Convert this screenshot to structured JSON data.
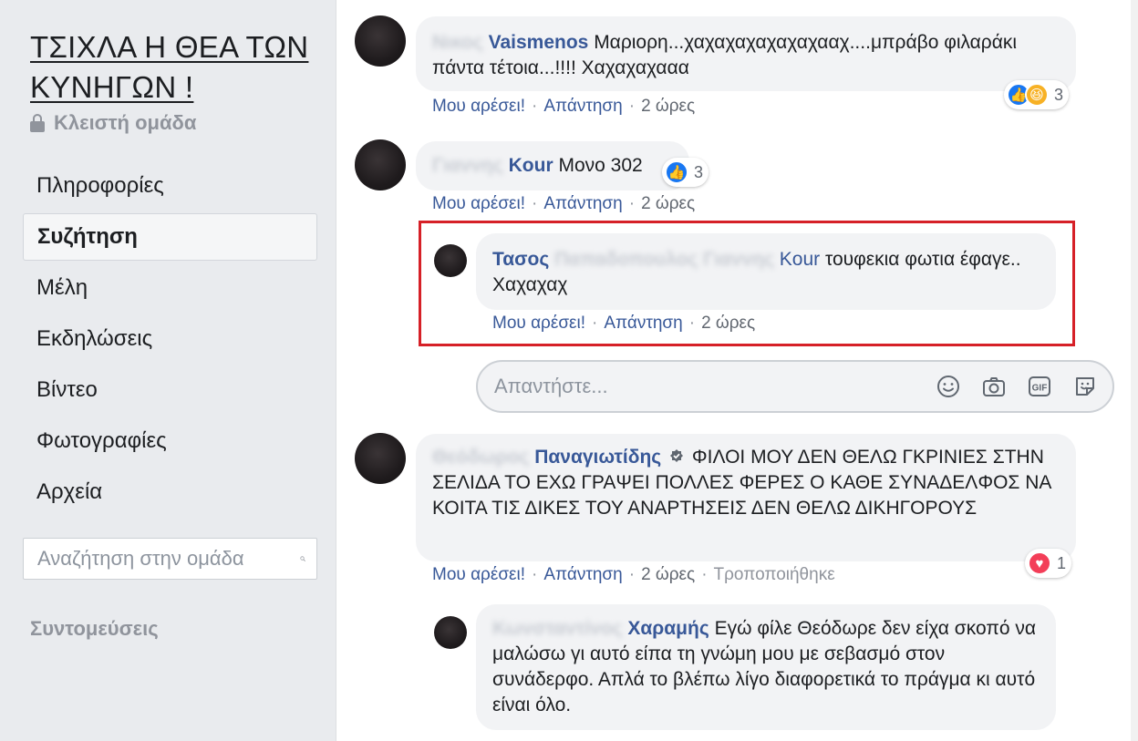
{
  "sidebar": {
    "group_title": "ΤΣΙΧΛΑ Η ΘΕΑ ΤΩΝ ΚΥΝΗΓΩΝ !",
    "privacy": "Κλειστή ομάδα",
    "nav": [
      {
        "label": "Πληροφορίες"
      },
      {
        "label": "Συζήτηση",
        "active": true
      },
      {
        "label": "Μέλη"
      },
      {
        "label": "Εκδηλώσεις"
      },
      {
        "label": "Βίντεο"
      },
      {
        "label": "Φωτογραφίες"
      },
      {
        "label": "Αρχεία"
      }
    ],
    "search_placeholder": "Αναζήτηση στην ομάδα",
    "shortcuts": "Συντομεύσεις"
  },
  "comments": [
    {
      "author_visible": "Vaismenos",
      "author_blurred": "Νικος",
      "text": "Μαριορη...χαχαχαχαχαχαχααχ....μπράβο φιλαράκι πάντα τέτοια...!!!! Χαχαχαχααα",
      "like": "Μου αρέσει!",
      "reply": "Απάντηση",
      "time": "2 ώρες",
      "reactions": {
        "icons": [
          "like-icon",
          "haha-icon"
        ],
        "count": "3"
      }
    },
    {
      "author_visible": "Kour",
      "author_blurred": "Γιαννης",
      "text": "Μονο 302",
      "like": "Μου αρέσει!",
      "reply": "Απάντηση",
      "time": "2 ώρες",
      "reactions": {
        "icons": [
          "like-icon"
        ],
        "count": "3"
      },
      "replies": [
        {
          "author_visible": "Τασος",
          "author_blurred": "Παπαδοπουλος Γιαννης",
          "mention": "Kour",
          "text": "τουφεκια φωτια έφαγε.. Χαχαχαχ",
          "like": "Μου αρέσει!",
          "reply": "Απάντηση",
          "time": "2 ώρες"
        }
      ],
      "reply_placeholder": "Απαντήστε..."
    },
    {
      "author_visible": "Παναγιωτίδης",
      "author_blurred": "Θεόδωρος",
      "text": "ΦΙΛΟΙ ΜΟΥ ΔΕΝ ΘΕΛΩ ΓΚΡΙΝΙΕΣ ΣΤΗΝ ΣΕΛΙΔΑ ΤΟ ΕΧΩ ΓΡΑΨΕΙ ΠΟΛΛΕΣ ΦΕΡΕΣ Ο ΚΑΘΕ ΣΥΝΑΔΕΛΦΟΣ ΝΑ ΚΟΙΤΑ ΤΙΣ ΔΙΚΕΣ ΤΟΥ ΑΝΑΡΤΗΣΕΙΣ ΔΕΝ ΘΕΛΩ ΔΙΚΗΓΟΡΟΥΣ",
      "like": "Μου αρέσει!",
      "reply": "Απάντηση",
      "time": "2 ώρες",
      "edited": "Τροποποιήθηκε",
      "reactions": {
        "icons": [
          "love-icon"
        ],
        "count": "1"
      },
      "replies": [
        {
          "author_visible": "Χαραμής",
          "author_blurred": "Κωνσταντίνος",
          "text": "Εγώ φίλε Θεόδωρε δεν είχα σκοπό να μαλώσω γι αυτό είπα τη γνώμη μου με σεβασμό στον συνάδερφο. Απλά το βλέπω λίγο διαφορετικά το πράγμα κι αυτό είναι όλο."
        }
      ]
    }
  ],
  "colors": {
    "link": "#385898",
    "bubble": "#f2f3f5",
    "sidebar_bg": "#e9ebee",
    "highlight": "#d62027",
    "like": "#1877f2",
    "love": "#f33e58",
    "haha": "#f7b125"
  }
}
